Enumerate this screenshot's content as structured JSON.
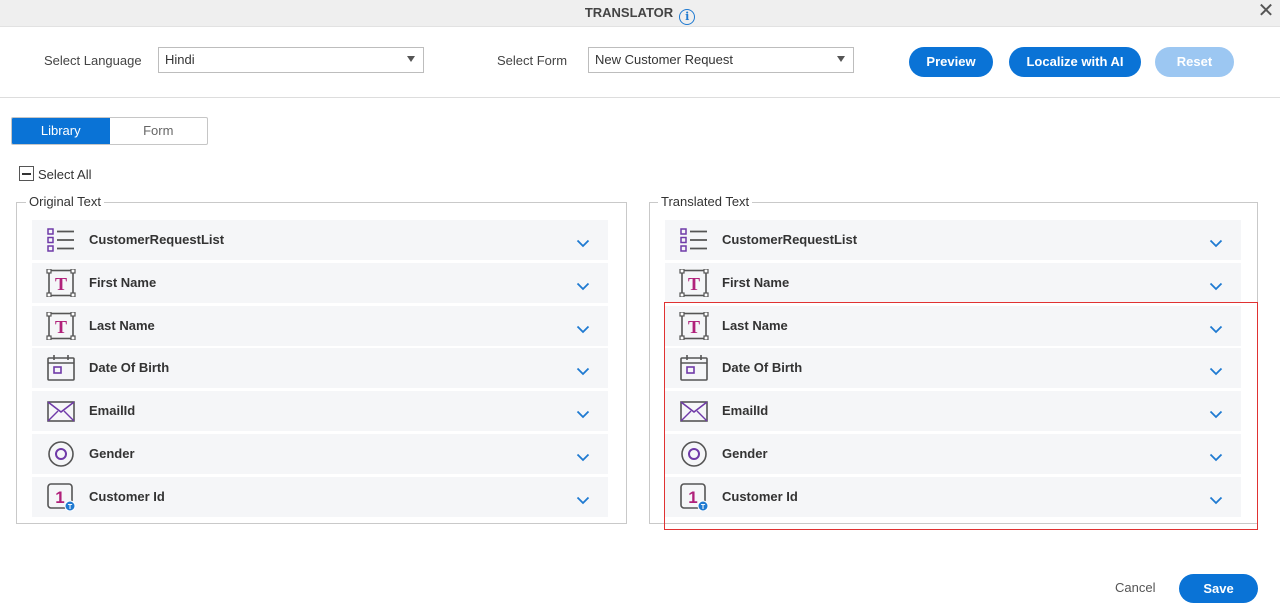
{
  "window": {
    "title": "TRANSLATOR",
    "info_icon": "info-icon",
    "close_icon": "close-icon"
  },
  "toolbar": {
    "language_label": "Select Language",
    "language_value": "Hindi",
    "form_label": "Select Form",
    "form_value": "New Customer Request",
    "preview_label": "Preview",
    "localize_label": "Localize with AI",
    "reset_label": "Reset"
  },
  "tabs": [
    {
      "label": "Library",
      "active": true
    },
    {
      "label": "Form",
      "active": false
    }
  ],
  "select_all_label": "Select All",
  "original_panel": {
    "legend": "Original Text",
    "items": [
      {
        "label": "CustomerRequestList",
        "icon": "list-icon"
      },
      {
        "label": "First Name",
        "icon": "text-field-icon"
      },
      {
        "label": "Last Name",
        "icon": "text-field-icon"
      },
      {
        "label": "Date Of Birth",
        "icon": "calendar-icon"
      },
      {
        "label": "EmailId",
        "icon": "email-icon"
      },
      {
        "label": "Gender",
        "icon": "radio-icon"
      },
      {
        "label": "Customer Id",
        "icon": "number-field-icon"
      }
    ]
  },
  "translated_panel": {
    "legend": "Translated Text",
    "items": [
      {
        "label": "CustomerRequestList",
        "icon": "list-icon"
      },
      {
        "label": "First Name",
        "icon": "text-field-icon"
      },
      {
        "label": "Last Name",
        "icon": "text-field-icon"
      },
      {
        "label": "Date Of Birth",
        "icon": "calendar-icon"
      },
      {
        "label": "EmailId",
        "icon": "email-icon"
      },
      {
        "label": "Gender",
        "icon": "radio-icon"
      },
      {
        "label": "Customer Id",
        "icon": "number-field-icon"
      }
    ]
  },
  "footer": {
    "cancel_label": "Cancel",
    "save_label": "Save"
  },
  "colors": {
    "primary": "#0a73d6",
    "primary_disabled": "#9cc7f2",
    "highlight_border": "#e03232",
    "icon_purple": "#6f3aa8",
    "icon_magenta": "#b0207a",
    "row_bg": "#f5f6f8"
  }
}
